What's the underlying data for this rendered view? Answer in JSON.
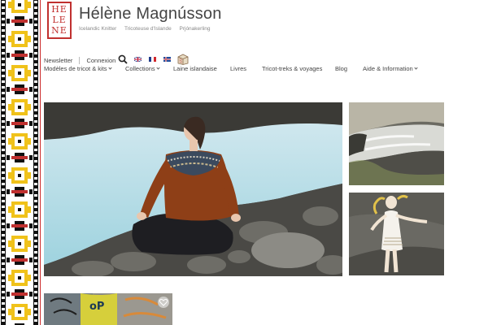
{
  "site": {
    "logo_lines": [
      "HE",
      "LE",
      "NE"
    ],
    "title": "Hélène Magnússon",
    "taglines": [
      "Icelandic Knitter",
      "Tricoteuse d'Islande",
      "Prjónakerling"
    ]
  },
  "utility": {
    "newsletter": "Newsletter",
    "login": "Connexion",
    "icons": [
      "search-icon",
      "flag-uk-icon",
      "flag-fr-icon",
      "flag-is-icon",
      "cart-icon"
    ]
  },
  "nav": [
    {
      "label": "Modèles de tricot & kits",
      "dropdown": true
    },
    {
      "label": "Collections",
      "dropdown": true
    },
    {
      "label": "Laine islandaise",
      "dropdown": false
    },
    {
      "label": "Livres",
      "dropdown": false
    },
    {
      "label": "Tricot-treks & voyages",
      "dropdown": false
    },
    {
      "label": "Blog",
      "dropdown": false
    },
    {
      "label": "Aide & Information",
      "dropdown": true
    }
  ],
  "colors": {
    "brand_red": "#c0302f",
    "band_yellow": "#f0c21a",
    "band_black": "#111111"
  },
  "gallery_icons": [
    "heart-icon"
  ]
}
